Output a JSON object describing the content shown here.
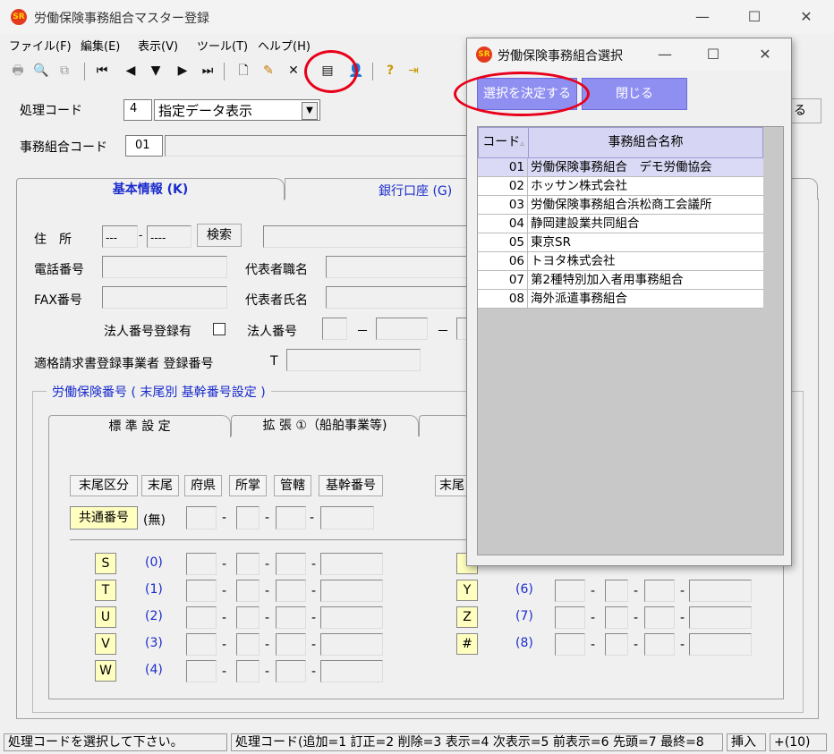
{
  "window": {
    "title": "労働保険事務組合マスター登録",
    "min": "—",
    "max": "☐",
    "close": "✕",
    "icon_text": "SR"
  },
  "menu": [
    "ファイル(F)",
    "編集(E)",
    "表示(V)",
    "ツール(T)",
    "ヘルプ(H)"
  ],
  "toolbar": {
    "print": "🖶",
    "preview": "🔍",
    "copy": "⧉",
    "first": "⏮",
    "prev": "◀",
    "down": "▼",
    "next": "▶",
    "last": "⏭",
    "new": "🗋",
    "edit": "✎",
    "delete": "✕",
    "list": "▤",
    "person": "👤",
    "help": "?",
    "exit": "⇥"
  },
  "form": {
    "shori_code_label": "処理コード",
    "shori_code_value": "4",
    "shori_mode": "指定データ表示",
    "jimu_code_label": "事務組合コード",
    "jimu_code_value": "01",
    "right_btn_partial": "る"
  },
  "tabs": {
    "basic": "基本情報 (K)",
    "bank": "銀行口座 (G)"
  },
  "basic": {
    "address_label": "住　所",
    "zip1": "---",
    "zip2": "----",
    "search_btn": "検索",
    "tel_label": "電話番号",
    "fax_label": "FAX番号",
    "rep_title_label": "代表者職名",
    "rep_name_label": "代表者氏名",
    "corp_reg_label": "法人番号登録有",
    "corp_no_label": "法人番号",
    "dash": "－",
    "invoice_label": "適格請求書登録事業者 登録番号",
    "invoice_prefix": "T",
    "insurance_group": "労働保険番号 ( 末尾別 基幹番号設定 )"
  },
  "subtabs": {
    "standard": "標 準 設 定",
    "ext1": "拡 張 ①（船舶事業等)"
  },
  "insurance": {
    "headers": [
      "末尾区分",
      "末尾",
      "府県",
      "所掌",
      "管轄",
      "基幹番号"
    ],
    "right_header_partial": "末尾",
    "common_label": "共通番号",
    "common_mark": "(無)",
    "left_rows": [
      {
        "code": "S",
        "num": "(0)"
      },
      {
        "code": "T",
        "num": "(1)"
      },
      {
        "code": "U",
        "num": "(2)"
      },
      {
        "code": "V",
        "num": "(3)"
      },
      {
        "code": "W",
        "num": "(4)"
      }
    ],
    "right_rows": [
      {
        "code": "Y",
        "num": "(6)"
      },
      {
        "code": "Z",
        "num": "(7)"
      },
      {
        "code": "#",
        "num": "(8)"
      }
    ]
  },
  "status": {
    "message": "処理コードを選択して下さい。",
    "hint": "処理コード(追加=1 訂正=2 削除=3 表示=4 次表示=5 前表示=6 先頭=7 最終=8",
    "mode": "挿入",
    "extra": "+(10)"
  },
  "dialog": {
    "title": "労働保険事務組合選択",
    "min": "—",
    "max": "☐",
    "close": "✕",
    "decide_btn": "選択を決定する",
    "close_btn": "閉じる",
    "col_code": "コード",
    "col_name": "事務組合名称",
    "rows": [
      {
        "code": "01",
        "name": "労働保険事務組合　デモ労働協会"
      },
      {
        "code": "02",
        "name": "ホッサン株式会社"
      },
      {
        "code": "03",
        "name": "労働保険事務組合浜松商工会議所"
      },
      {
        "code": "04",
        "name": "静岡建設業共同組合"
      },
      {
        "code": "05",
        "name": "東京SR"
      },
      {
        "code": "06",
        "name": "トヨタ株式会社"
      },
      {
        "code": "07",
        "name": "第2種特別加入者用事務組合"
      },
      {
        "code": "08",
        "name": "海外派遣事務組合"
      }
    ]
  },
  "colors": {
    "accent": "#1a2ccc",
    "dialog_button": "#8f8ff2",
    "highlight_ring": "#e8001a",
    "yellow_cell": "#ffffc0"
  }
}
